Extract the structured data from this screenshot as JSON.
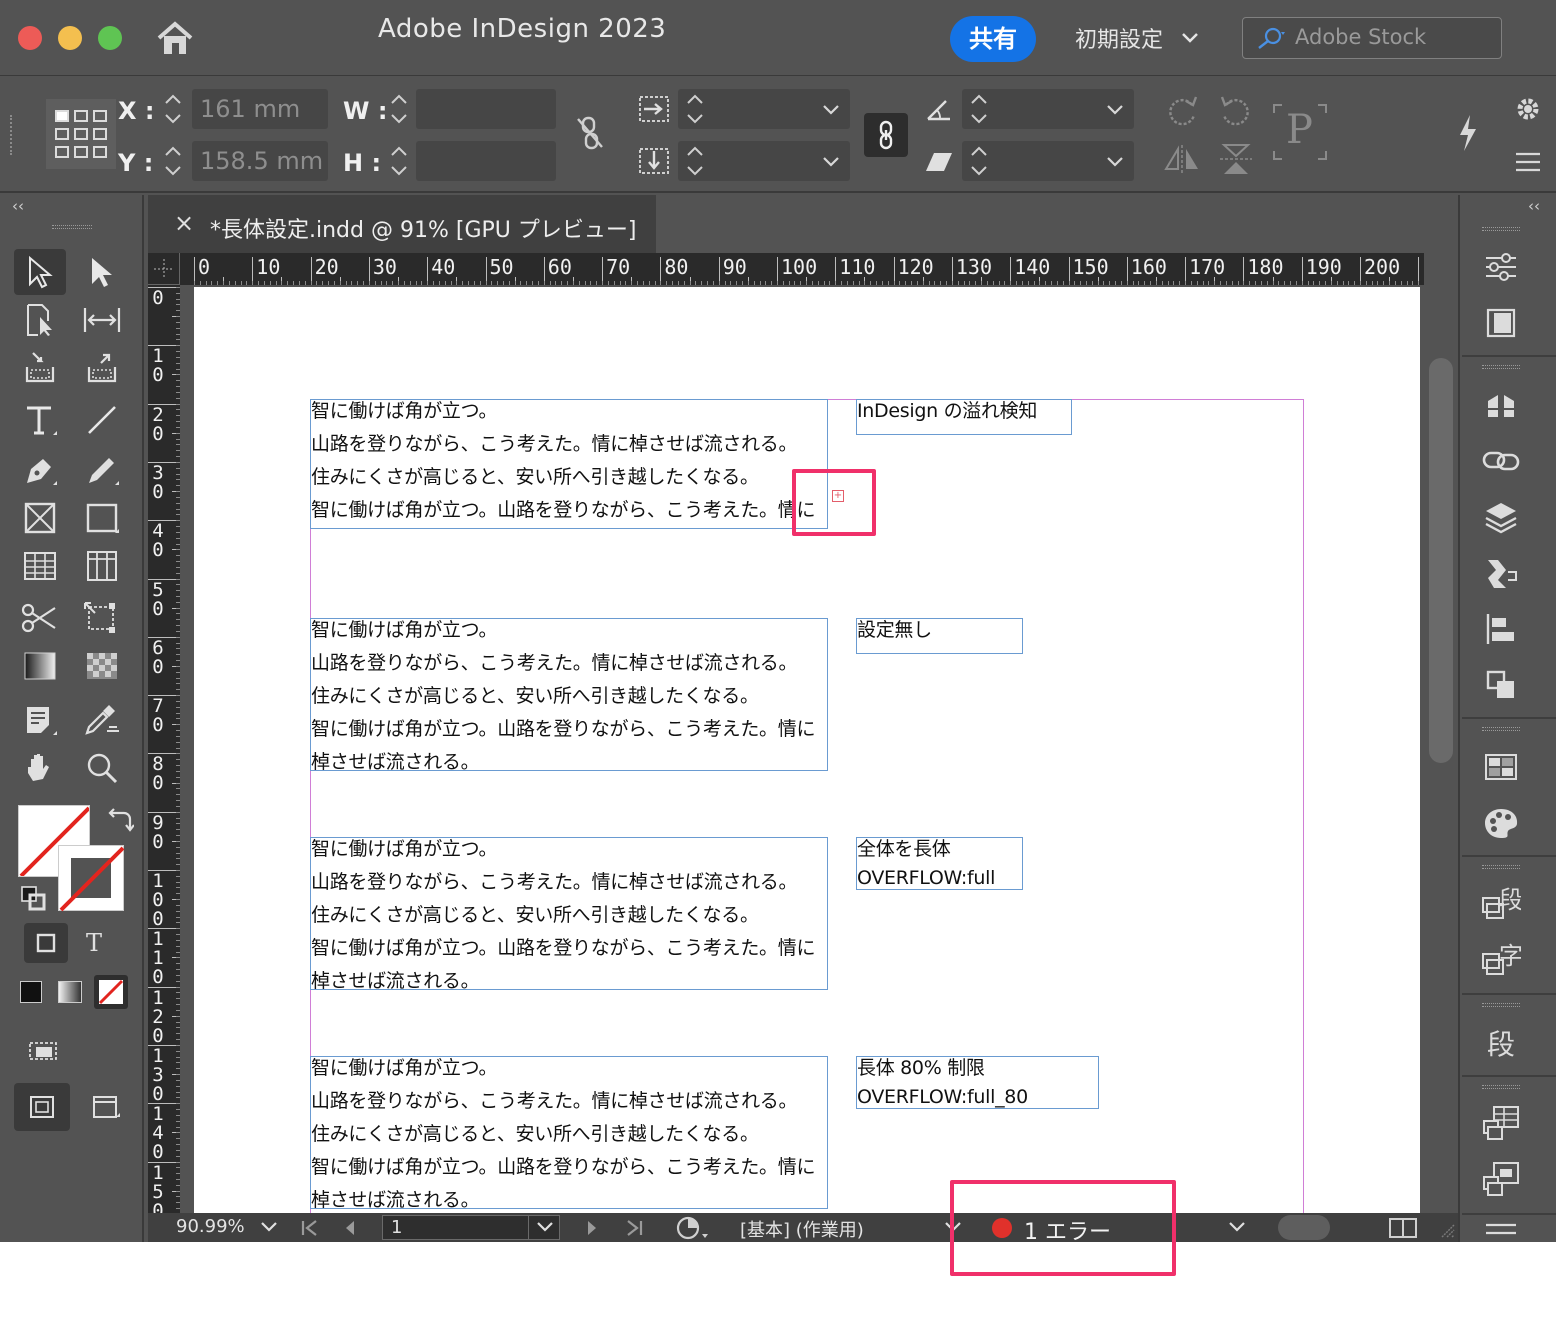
{
  "app": {
    "title": "Adobe InDesign 2023",
    "share_label": "共有",
    "workspace_label": "初期設定",
    "stock_placeholder": "Adobe Stock"
  },
  "control": {
    "x_label": "X :",
    "y_label": "Y :",
    "w_label": "W :",
    "h_label": "H :",
    "x_value": "161 mm",
    "y_value": "158.5 mm",
    "w_value": "",
    "h_value": "",
    "glyph_p": "P"
  },
  "document": {
    "tab_title": "*長体設定.indd @ 91% [GPU プレビュー]",
    "close_glyph": "×"
  },
  "ruler": {
    "h_ticks": [
      "0",
      "10",
      "20",
      "30",
      "40",
      "50",
      "60",
      "70",
      "80",
      "90",
      "100",
      "110",
      "120",
      "130",
      "140",
      "150",
      "160",
      "170",
      "180",
      "190",
      "200"
    ],
    "v_ticks": [
      [
        "0"
      ],
      [
        "1",
        "0"
      ],
      [
        "2",
        "0"
      ],
      [
        "3",
        "0"
      ],
      [
        "4",
        "0"
      ],
      [
        "5",
        "0"
      ],
      [
        "6",
        "0"
      ],
      [
        "7",
        "0"
      ],
      [
        "8",
        "0"
      ],
      [
        "9",
        "0"
      ],
      [
        "1",
        "0",
        "0"
      ],
      [
        "1",
        "1",
        "0"
      ],
      [
        "1",
        "2",
        "0"
      ],
      [
        "1",
        "3",
        "0"
      ],
      [
        "1",
        "4",
        "0"
      ],
      [
        "1",
        "5",
        "0"
      ]
    ]
  },
  "frames": [
    {
      "body": [
        "智に働けば角が立つ。",
        "山路を登りながら、こう考えた。情に棹させば流される。",
        "住みにくさが高じると、安い所へ引き越したくなる。",
        "智に働けば角が立つ。山路を登りながら、こう考えた。情に"
      ],
      "label": [
        "InDesign の溢れ検知"
      ]
    },
    {
      "body": [
        "智に働けば角が立つ。",
        "山路を登りながら、こう考えた。情に棹させば流される。",
        "住みにくさが高じると、安い所へ引き越したくなる。",
        "智に働けば角が立つ。山路を登りながら、こう考えた。情に",
        "棹させば流される。"
      ],
      "label": [
        "設定無し"
      ]
    },
    {
      "body": [
        "智に働けば角が立つ。",
        "山路を登りながら、こう考えた。情に棹させば流される。",
        "住みにくさが高じると、安い所へ引き越したくなる。",
        "智に働けば角が立つ。山路を登りながら、こう考えた。情に",
        "棹させば流される。"
      ],
      "label": [
        "全体を長体",
        "OVERFLOW:full"
      ]
    },
    {
      "body": [
        "智に働けば角が立つ。",
        "山路を登りながら、こう考えた。情に棹させば流される。",
        "住みにくさが高じると、安い所へ引き越したくなる。",
        "智に働けば角が立つ。山路を登りながら、こう考えた。情に",
        "棹させば流される。"
      ],
      "label": [
        "長体 80% 制限",
        "OVERFLOW:full_80"
      ]
    }
  ],
  "overflow_marker": "+",
  "status": {
    "zoom": "90.99%",
    "page": "1",
    "preflight_profile": "[基本] (作業用)",
    "error_count": "1 エラー"
  },
  "colors": {
    "accent_blue": "#1473e6",
    "error_red": "#e0312b",
    "callout_pink": "#f0306a",
    "frame_blue": "#6a9bd1",
    "margin_magenta": "#d07ed6"
  },
  "icons": {
    "toolbar": [
      "selection-icon",
      "direct-selection-icon",
      "page-tool-icon",
      "gap-tool-icon",
      "content-collector-icon",
      "content-placer-icon",
      "type-tool-icon",
      "line-tool-icon",
      "pen-tool-icon",
      "pencil-tool-icon",
      "rectangle-frame-icon",
      "rectangle-tool-icon",
      "table-icon",
      "grid-tool-icon",
      "scissors-icon",
      "free-transform-icon",
      "gradient-swatch-icon",
      "gradient-feather-icon",
      "note-tool-icon",
      "eyedropper-icon",
      "hand-tool-icon",
      "zoom-tool-icon"
    ],
    "dock": [
      "properties-icon",
      "pages-icon",
      "cc-libraries-icon",
      "links-icon",
      "layers-icon",
      "stroke-icon",
      "align-icon",
      "pathfinder-icon",
      "swatches-icon",
      "color-icon",
      "paragraph-styles-icon",
      "character-styles-icon",
      "paragraph-icon",
      "table-styles-icon",
      "cell-styles-icon",
      "menu-icon"
    ]
  }
}
